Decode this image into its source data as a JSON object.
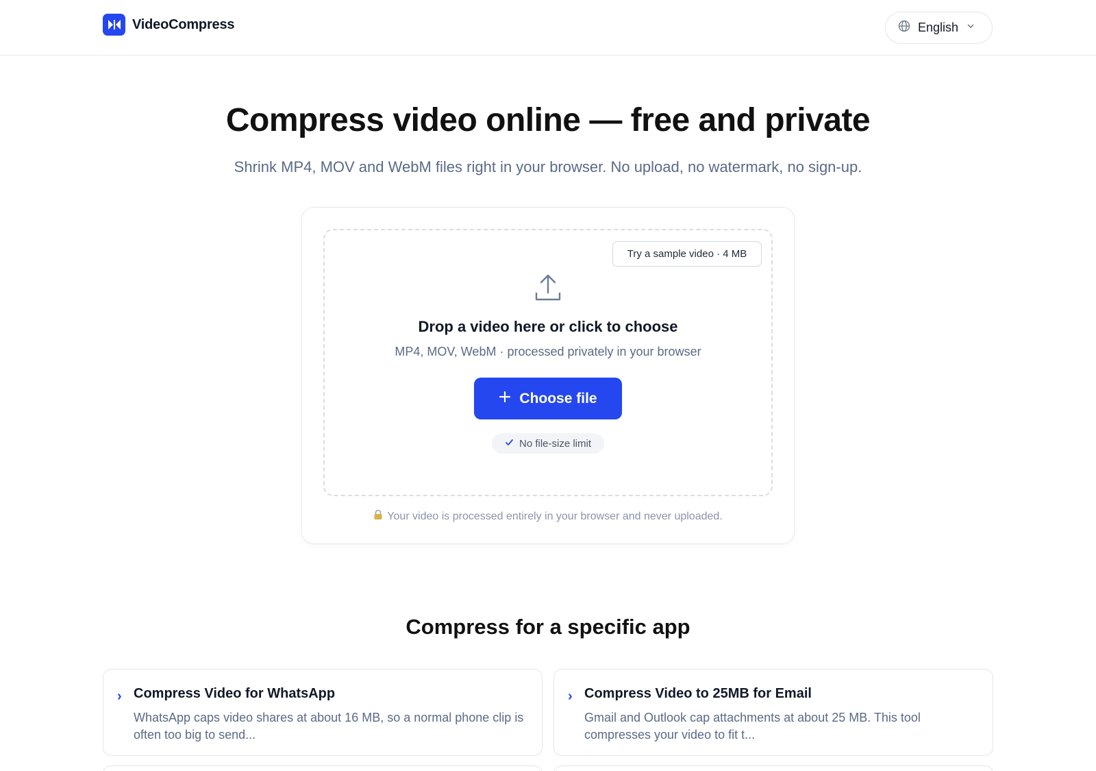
{
  "header": {
    "brand": "VideoCompress",
    "language": "English"
  },
  "hero": {
    "title": "Compress video online — free and private",
    "subtitle": "Shrink MP4, MOV and WebM files right in your browser. No upload, no watermark, no sign-up."
  },
  "uploader": {
    "sample_label": "Try a sample video · 4 MB",
    "drop_title": "Drop a video here or click to choose",
    "drop_subtitle": "MP4, MOV, WebM · processed privately in your browser",
    "choose_label": "Choose file",
    "limit_badge": "No file-size limit",
    "privacy_note": "Your video is processed entirely in your browser and never uploaded."
  },
  "apps_section": {
    "title": "Compress for a specific app",
    "cards": [
      {
        "title": "Compress Video for WhatsApp",
        "description": "WhatsApp caps video shares at about 16 MB, so a normal phone clip is often too big to send..."
      },
      {
        "title": "Compress Video to 25MB for Email",
        "description": "Gmail and Outlook cap attachments at about 25 MB. This tool compresses your video to fit t..."
      }
    ]
  },
  "colors": {
    "accent": "#2447ef",
    "muted_text": "#5b6a86"
  },
  "icons": [
    "logo-icon",
    "globe-icon",
    "chevron-down-icon",
    "upload-icon",
    "plus-icon",
    "check-icon",
    "lock-icon",
    "chevron-right-icon"
  ]
}
